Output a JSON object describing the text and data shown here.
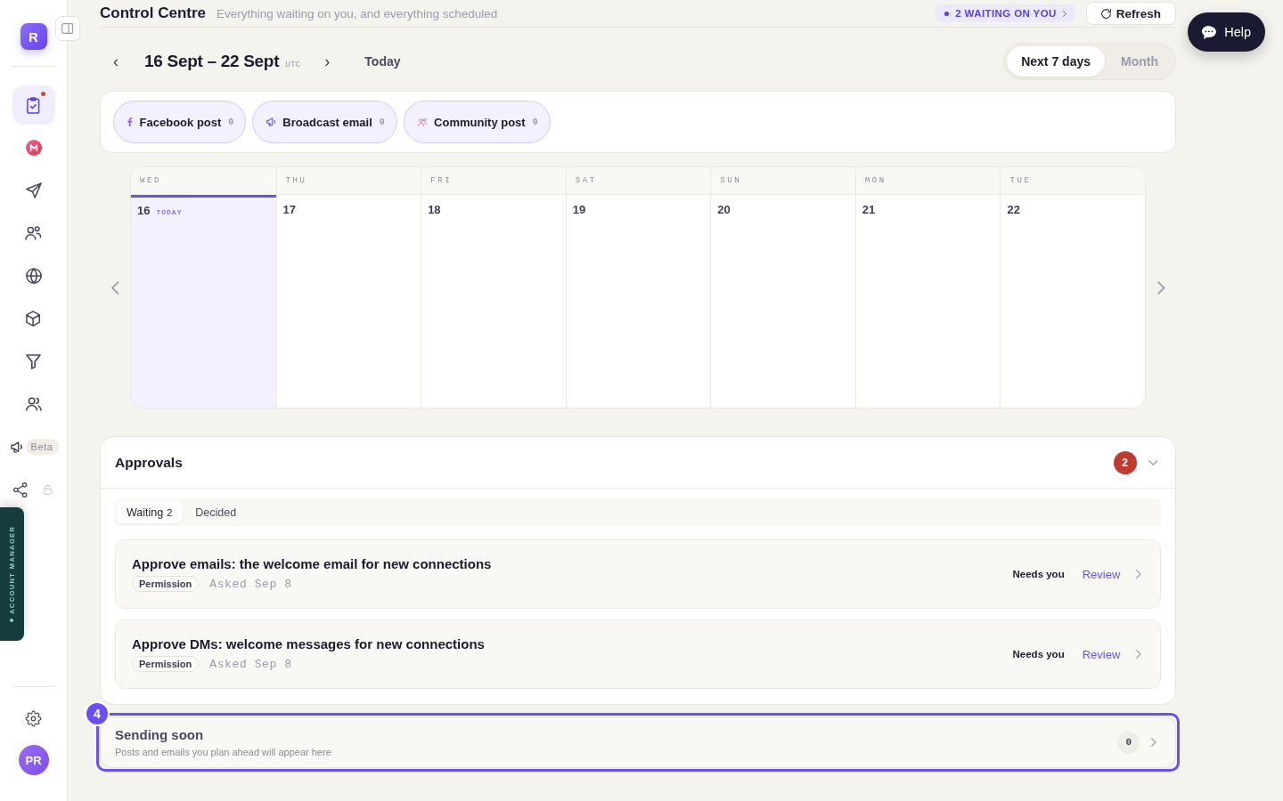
{
  "sidebar": {
    "logo": "R",
    "nav": [
      {
        "kind": "clipboard",
        "selected": true,
        "alert": true,
        "locked": false
      },
      {
        "kind": "mark",
        "selected": false,
        "alert": false,
        "locked": false
      },
      {
        "kind": "send",
        "selected": false,
        "alert": false,
        "locked": false
      },
      {
        "kind": "friends",
        "selected": false,
        "alert": false,
        "locked": false
      },
      {
        "kind": "globe",
        "selected": false,
        "alert": false,
        "locked": false
      },
      {
        "kind": "cube",
        "selected": false,
        "alert": false,
        "locked": false
      },
      {
        "kind": "funnel",
        "selected": false,
        "alert": false,
        "locked": false
      },
      {
        "kind": "team",
        "selected": false,
        "alert": false,
        "locked": false
      },
      {
        "kind": "megaphone",
        "selected": false,
        "alert": false,
        "locked": false,
        "badge": "Beta"
      },
      {
        "kind": "share",
        "selected": false,
        "alert": false,
        "locked": true
      }
    ],
    "account_manager": "ACCOUNT MANAGER",
    "avatar": "PR"
  },
  "header": {
    "title": "Control Centre",
    "subtitle": "Everything waiting on you, and everything scheduled",
    "waiting": "2 WAITING ON YOU",
    "refresh": "Refresh"
  },
  "date_nav": {
    "prev": "‹",
    "range": "16 Sept – 22 Sept",
    "timezone": "UTC",
    "next": "›",
    "today": "Today",
    "views": [
      {
        "label": "Next 7 days",
        "selected": true
      },
      {
        "label": "Month",
        "selected": false
      }
    ]
  },
  "filters": [
    {
      "kind": "facebook",
      "label": "Facebook post",
      "count": "0"
    },
    {
      "kind": "broadcast",
      "label": "Broadcast email",
      "count": "0"
    },
    {
      "kind": "community",
      "label": "Community post",
      "count": "0"
    }
  ],
  "calendar": {
    "days": [
      {
        "weekday": "WED",
        "date": "16",
        "today": true,
        "tag": "TODAY"
      },
      {
        "weekday": "THU",
        "date": "17",
        "today": false
      },
      {
        "weekday": "FRI",
        "date": "18",
        "today": false
      },
      {
        "weekday": "SAT",
        "date": "19",
        "today": false
      },
      {
        "weekday": "SUN",
        "date": "20",
        "today": false
      },
      {
        "weekday": "MON",
        "date": "21",
        "today": false
      },
      {
        "weekday": "TUE",
        "date": "22",
        "today": false
      }
    ]
  },
  "approvals": {
    "title": "Approvals",
    "count": "2",
    "expanded": true,
    "tabs": [
      {
        "label": "Waiting",
        "count": "2",
        "selected": true
      },
      {
        "label": "Decided",
        "selected": false
      }
    ],
    "items": [
      {
        "title": "Approve emails: the welcome email for new connections",
        "tag": "Permission",
        "asked": "Asked Sep 8",
        "status": "Needs you",
        "action": "Review"
      },
      {
        "title": "Approve DMs: welcome messages for new connections",
        "tag": "Permission",
        "asked": "Asked Sep 8",
        "status": "Needs you",
        "action": "Review"
      }
    ]
  },
  "sending_soon": {
    "title": "Sending soon",
    "subtitle": "Posts and emails you plan ahead will appear here",
    "count": "0",
    "highlighted": true,
    "step": "4"
  },
  "help": "Help"
}
